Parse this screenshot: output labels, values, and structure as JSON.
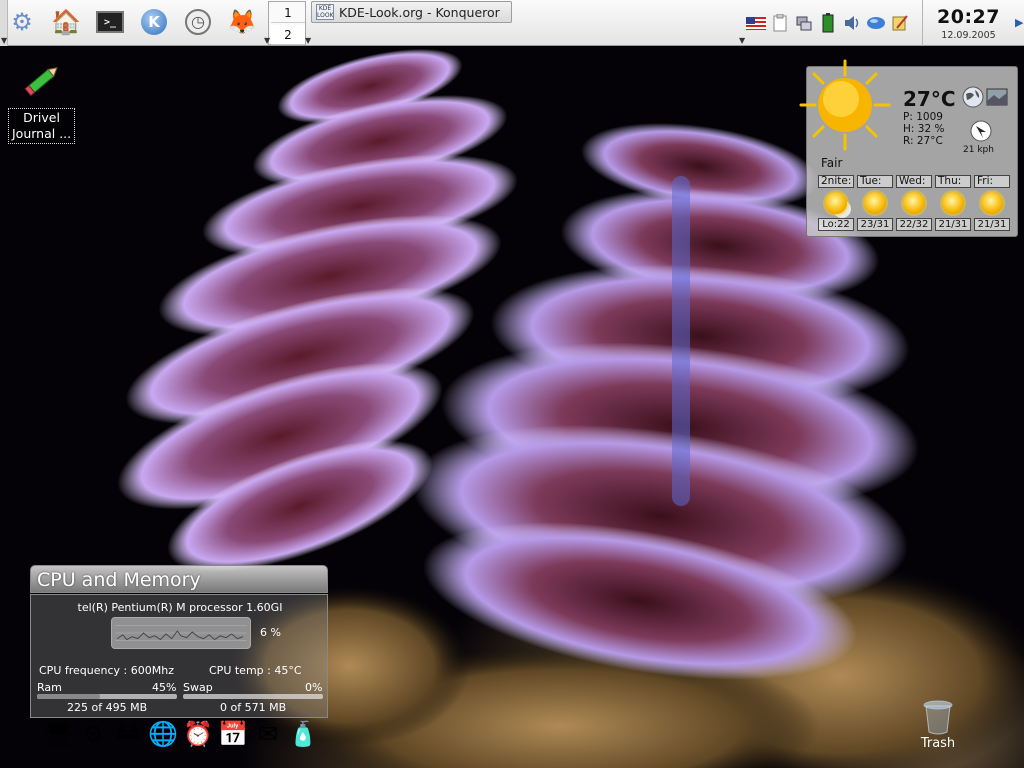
{
  "panel": {
    "launchers": [
      {
        "name": "kde-menu-icon",
        "glyph": "⚙"
      },
      {
        "name": "home-folder-icon",
        "glyph": "🏠"
      },
      {
        "name": "terminal-icon",
        "glyph": ">_"
      },
      {
        "name": "konqueror-icon",
        "glyph": "K"
      },
      {
        "name": "clock-settings-icon",
        "glyph": "◷"
      },
      {
        "name": "firefox-icon",
        "glyph": "🦊"
      }
    ],
    "desktops": [
      "1",
      "2"
    ],
    "taskbar": {
      "icon_text": "KDE LOOK",
      "window_title": "KDE-Look.org - Konqueror"
    },
    "clock": {
      "time": "20:27",
      "date": "12.09.2005"
    }
  },
  "desktop_icons": {
    "journal_label_line1": "Drivel",
    "journal_label_line2": "Journal ...",
    "trash_label": "Trash"
  },
  "weather": {
    "temperature": "27°C",
    "pressure": "P: 1009",
    "humidity": "H: 32 %",
    "real_feel": "R: 27°C",
    "condition": "Fair",
    "wind": "21 kph",
    "forecast": [
      {
        "day": "2nite:",
        "temp": "Lo:22"
      },
      {
        "day": "Tue:",
        "temp": "23/31"
      },
      {
        "day": "Wed:",
        "temp": "22/32"
      },
      {
        "day": "Thu:",
        "temp": "21/31"
      },
      {
        "day": "Fri:",
        "temp": "21/31"
      }
    ]
  },
  "cpu_widget": {
    "title": "CPU and Memory",
    "processor": "tel(R) Pentium(R) M processor 1.60GI",
    "cpu_usage": "6 %",
    "cpu_frequency": "CPU frequency : 600Mhz",
    "cpu_temp": "CPU temp : 45°C",
    "ram_label": "Ram",
    "ram_pct": "45%",
    "ram_detail": "225 of 495 MB",
    "ram_fraction": 0.45,
    "swap_label": "Swap",
    "swap_pct": "0%",
    "swap_detail": "0 of 571 MB",
    "swap_fraction": 0.0
  },
  "dock": [
    {
      "name": "computer-icon",
      "glyph": "🖥"
    },
    {
      "name": "system-icon",
      "glyph": "⚙"
    },
    {
      "name": "harddisk-icon",
      "glyph": "🖴"
    },
    {
      "name": "network-globe-icon",
      "glyph": "🌐"
    },
    {
      "name": "alarm-clock-icon",
      "glyph": "⏰"
    },
    {
      "name": "calendar-icon",
      "glyph": "📅"
    },
    {
      "name": "mail-icon",
      "glyph": "✉"
    },
    {
      "name": "package-icon",
      "glyph": "🧴"
    }
  ],
  "colors": {
    "panel_bg": "#f0f0f0",
    "text_dark": "#111111",
    "sun": "#f7b500"
  }
}
